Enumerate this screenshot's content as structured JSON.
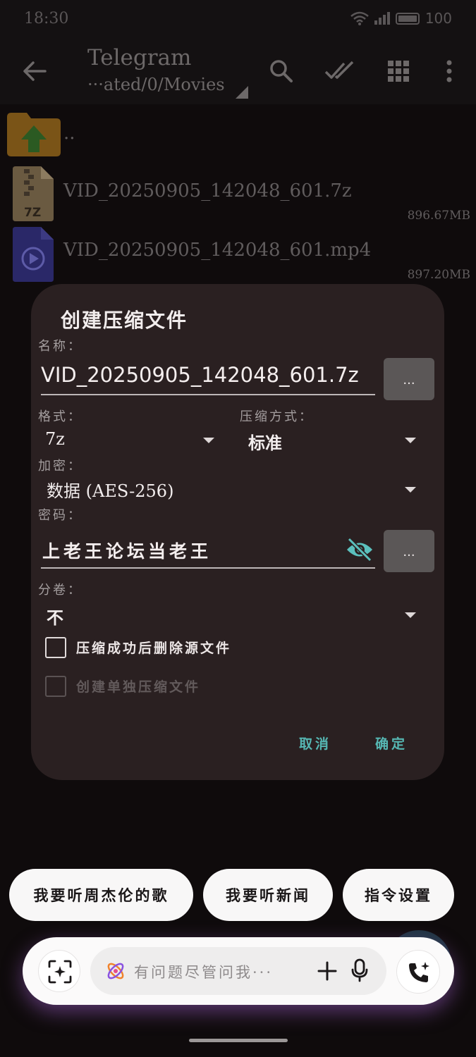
{
  "status_bar": {
    "time": "18:30",
    "battery": "100"
  },
  "app_bar": {
    "title": "Telegram",
    "path": "···ated/0/Movies",
    "icons": [
      "back-arrow-icon",
      "search-icon",
      "double-check-icon",
      "grid-icon",
      "more-vert-icon"
    ]
  },
  "files": [
    {
      "name": "..",
      "size": "",
      "icon": "folder-up-icon"
    },
    {
      "name": "VID_20250905_142048_601.7z",
      "size": "896.67MB",
      "icon": "7z-archive-icon",
      "badge": "7Z"
    },
    {
      "name": "VID_20250905_142048_601.mp4",
      "size": "897.20MB",
      "icon": "video-file-icon"
    }
  ],
  "dialog": {
    "title": "创建压缩文件",
    "name_label": "名称：",
    "name_value": "VID_20250905_142048_601.7z",
    "more_label": "...",
    "format_label": "格式：",
    "format_value": "7z",
    "method_label": "压缩方式：",
    "method_value": "标准",
    "encryption_label": "加密：",
    "encryption_value": "数据 (AES-256)",
    "password_label": "密码：",
    "password_value": "上老王论坛当老王",
    "split_label": "分卷：",
    "split_value": "不",
    "delete_source_label": "压缩成功后删除源文件",
    "delete_source_checked": false,
    "separate_archive_label": "创建单独压缩文件",
    "separate_archive_enabled": false,
    "cancel_label": "取消",
    "ok_label": "确定"
  },
  "suggestions": [
    "我要听周杰伦的歌",
    "我要听新闻",
    "指令设置"
  ],
  "assistant": {
    "placeholder": "有问题尽管问我···",
    "icons": [
      "scan-icon",
      "ai-sparkle-icon",
      "plus-icon",
      "mic-icon",
      "phone-sparkle-icon"
    ]
  },
  "colors": {
    "accent": "#56b7b3",
    "dialog_bg": "#2a2021",
    "background": "#0f0b0c"
  }
}
